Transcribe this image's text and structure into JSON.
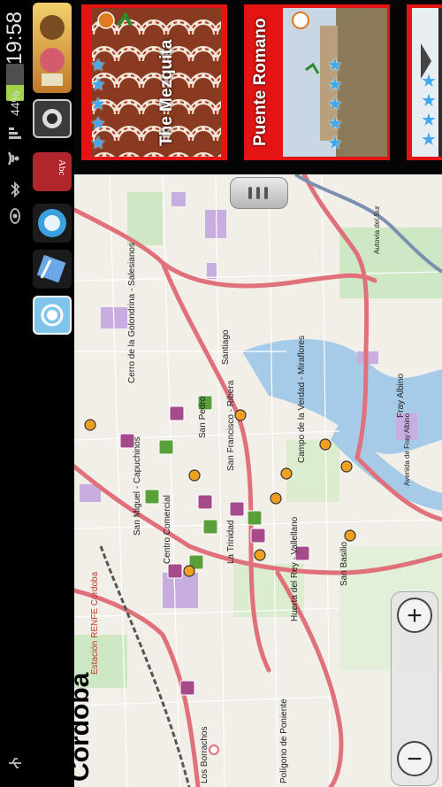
{
  "status_bar": {
    "time": "19:58",
    "battery_percent": "44%",
    "battery_level": 0.44,
    "icons": [
      "signal-icon",
      "wifi-icon",
      "bluetooth-icon",
      "eye-icon",
      "usb-icon"
    ]
  },
  "apps": [
    {
      "name": "app-food-icon",
      "color": "#7a5030"
    },
    {
      "name": "app-camera-icon",
      "color": "#dcdcdc"
    },
    {
      "name": "app-dictionary-icon",
      "color": "#b0262a"
    },
    {
      "name": "app-media-icon",
      "color": "#3aa0e0"
    },
    {
      "name": "app-sync-icon",
      "color": "#3a7fd0"
    },
    {
      "name": "app-radio-icon",
      "color": "#2f9fe0"
    }
  ],
  "cards": [
    {
      "title": "The Mezquita",
      "rating_stars": 5
    },
    {
      "title": "Puente Romano",
      "rating_stars": 5
    },
    {
      "title": "",
      "rating_stars": 4
    }
  ],
  "map": {
    "city": "Cordoba",
    "street_labels": [
      "Cerro de la Golondrina - Salesianos",
      "Santiago",
      "San Pedro",
      "San Francisco - Ribera",
      "Campo de la Verdad - Miraflores",
      "Fray Albino",
      "San Miguel - Capuchinos",
      "Centro Comercial",
      "La Trinidad",
      "Huerta del Rey - Vallellano",
      "San Basilio",
      "Estación RENFE Córdoba",
      "Polígono de Poniente",
      "Los Borrachos",
      "Avenida de Fray Albino",
      "Autovía del Sur"
    ],
    "zoom_in_label": "+",
    "zoom_out_label": "−"
  }
}
